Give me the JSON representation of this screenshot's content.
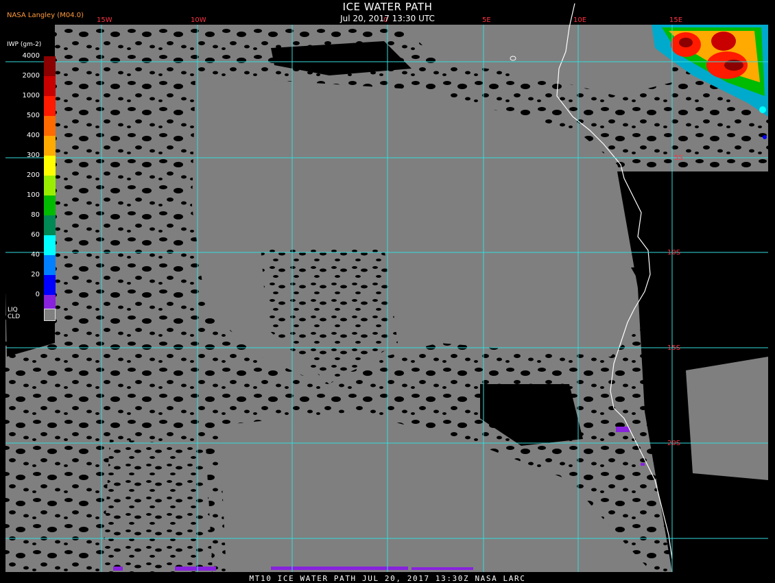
{
  "header": {
    "title": "ICE WATER PATH",
    "datetime": "Jul 20, 2017 13:30 UTC",
    "org": "NASA Langley (M04.0)"
  },
  "footer": {
    "text": "MT10  ICE WATER PATH  JUL 20, 2017 13:30Z  NASA LARC"
  },
  "legend": {
    "title": "IWP (gm-2)",
    "levels": [
      {
        "label": "4000",
        "color": "#8b0000"
      },
      {
        "label": "2000",
        "color": "#c80000"
      },
      {
        "label": "1000",
        "color": "#ff1a00"
      },
      {
        "label": "500",
        "color": "#ff6a00"
      },
      {
        "label": "400",
        "color": "#ffaa00"
      },
      {
        "label": "300",
        "color": "#ffff00"
      },
      {
        "label": "200",
        "color": "#99ee00"
      },
      {
        "label": "100",
        "color": "#00bb00"
      },
      {
        "label": "80",
        "color": "#008855"
      },
      {
        "label": "60",
        "color": "#00ffff"
      },
      {
        "label": "40",
        "color": "#0080ff"
      },
      {
        "label": "20",
        "color": "#0000ff"
      },
      {
        "label": "0",
        "color": "#8822dd"
      }
    ],
    "liquid_label_1": "LIQ",
    "liquid_label_2": "CLD",
    "liquid_color": "#808080"
  },
  "grid": {
    "color": "#33dddd",
    "lon_labels": [
      "15W",
      "10W",
      "0",
      "5E",
      "10E",
      "15E"
    ],
    "lat_labels": [
      "5S",
      "10S",
      "15S",
      "20S"
    ],
    "label_color": "#ff3344"
  }
}
